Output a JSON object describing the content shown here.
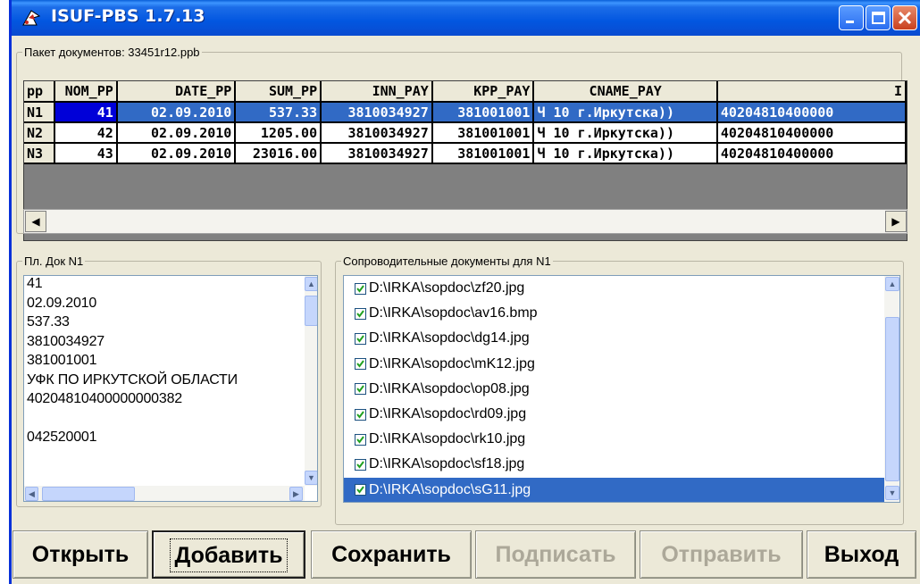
{
  "window": {
    "title": "ISUF-PBS  1.7.13"
  },
  "packet": {
    "label": "Пакет документов: 33451r12.ppb",
    "columns": [
      "pp",
      "NOM_PP",
      "DATE_PP",
      "SUM_PP",
      "INN_PAY",
      "KPP_PAY",
      "CNAME_PAY",
      "I"
    ],
    "rows": [
      [
        "N1",
        "41",
        "02.09.2010",
        "537.33",
        "3810034927",
        "381001001",
        "Ч 10 г.Иркутска))",
        "40204810400000"
      ],
      [
        "N2",
        "42",
        "02.09.2010",
        "1205.00",
        "3810034927",
        "381001001",
        "Ч 10 г.Иркутска))",
        "40204810400000"
      ],
      [
        "N3",
        "43",
        "02.09.2010",
        "23016.00",
        "3810034927",
        "381001001",
        "Ч 10 г.Иркутска))",
        "40204810400000"
      ]
    ],
    "selected_row": 0
  },
  "doc": {
    "label": "Пл. Док N1",
    "lines": [
      "41",
      "02.09.2010",
      "537.33",
      "3810034927",
      "381001001",
      "УФК ПО ИРКУТСКОЙ ОБЛАСТИ",
      "40204810400000000382",
      "",
      "042520001"
    ]
  },
  "attachments": {
    "label": "Сопроводительные документы для N1",
    "items": [
      "D:\\IRKA\\sopdoc\\zf20.jpg",
      "D:\\IRKA\\sopdoc\\av16.bmp",
      "D:\\IRKA\\sopdoc\\dg14.jpg",
      "D:\\IRKA\\sopdoc\\mK12.jpg",
      "D:\\IRKA\\sopdoc\\op08.jpg",
      "D:\\IRKA\\sopdoc\\rd09.jpg",
      "D:\\IRKA\\sopdoc\\rk10.jpg",
      "D:\\IRKA\\sopdoc\\sf18.jpg",
      "D:\\IRKA\\sopdoc\\sG11.jpg"
    ],
    "selected_index": 8
  },
  "buttons": {
    "open": "Открыть",
    "add": "Добавить",
    "save": "Сохранить",
    "sign": "Подписать",
    "send": "Отправить",
    "exit": "Выход"
  },
  "icons": {
    "app": "app-icon",
    "minimize": "minimize-icon",
    "maximize": "maximize-icon",
    "close": "close-icon",
    "checkbox": "checkmark-icon"
  },
  "colors": {
    "titlebar": "#0256e0",
    "selection": "#316ac5",
    "window_bg": "#ece9d8",
    "disabled_text": "#aca899"
  }
}
